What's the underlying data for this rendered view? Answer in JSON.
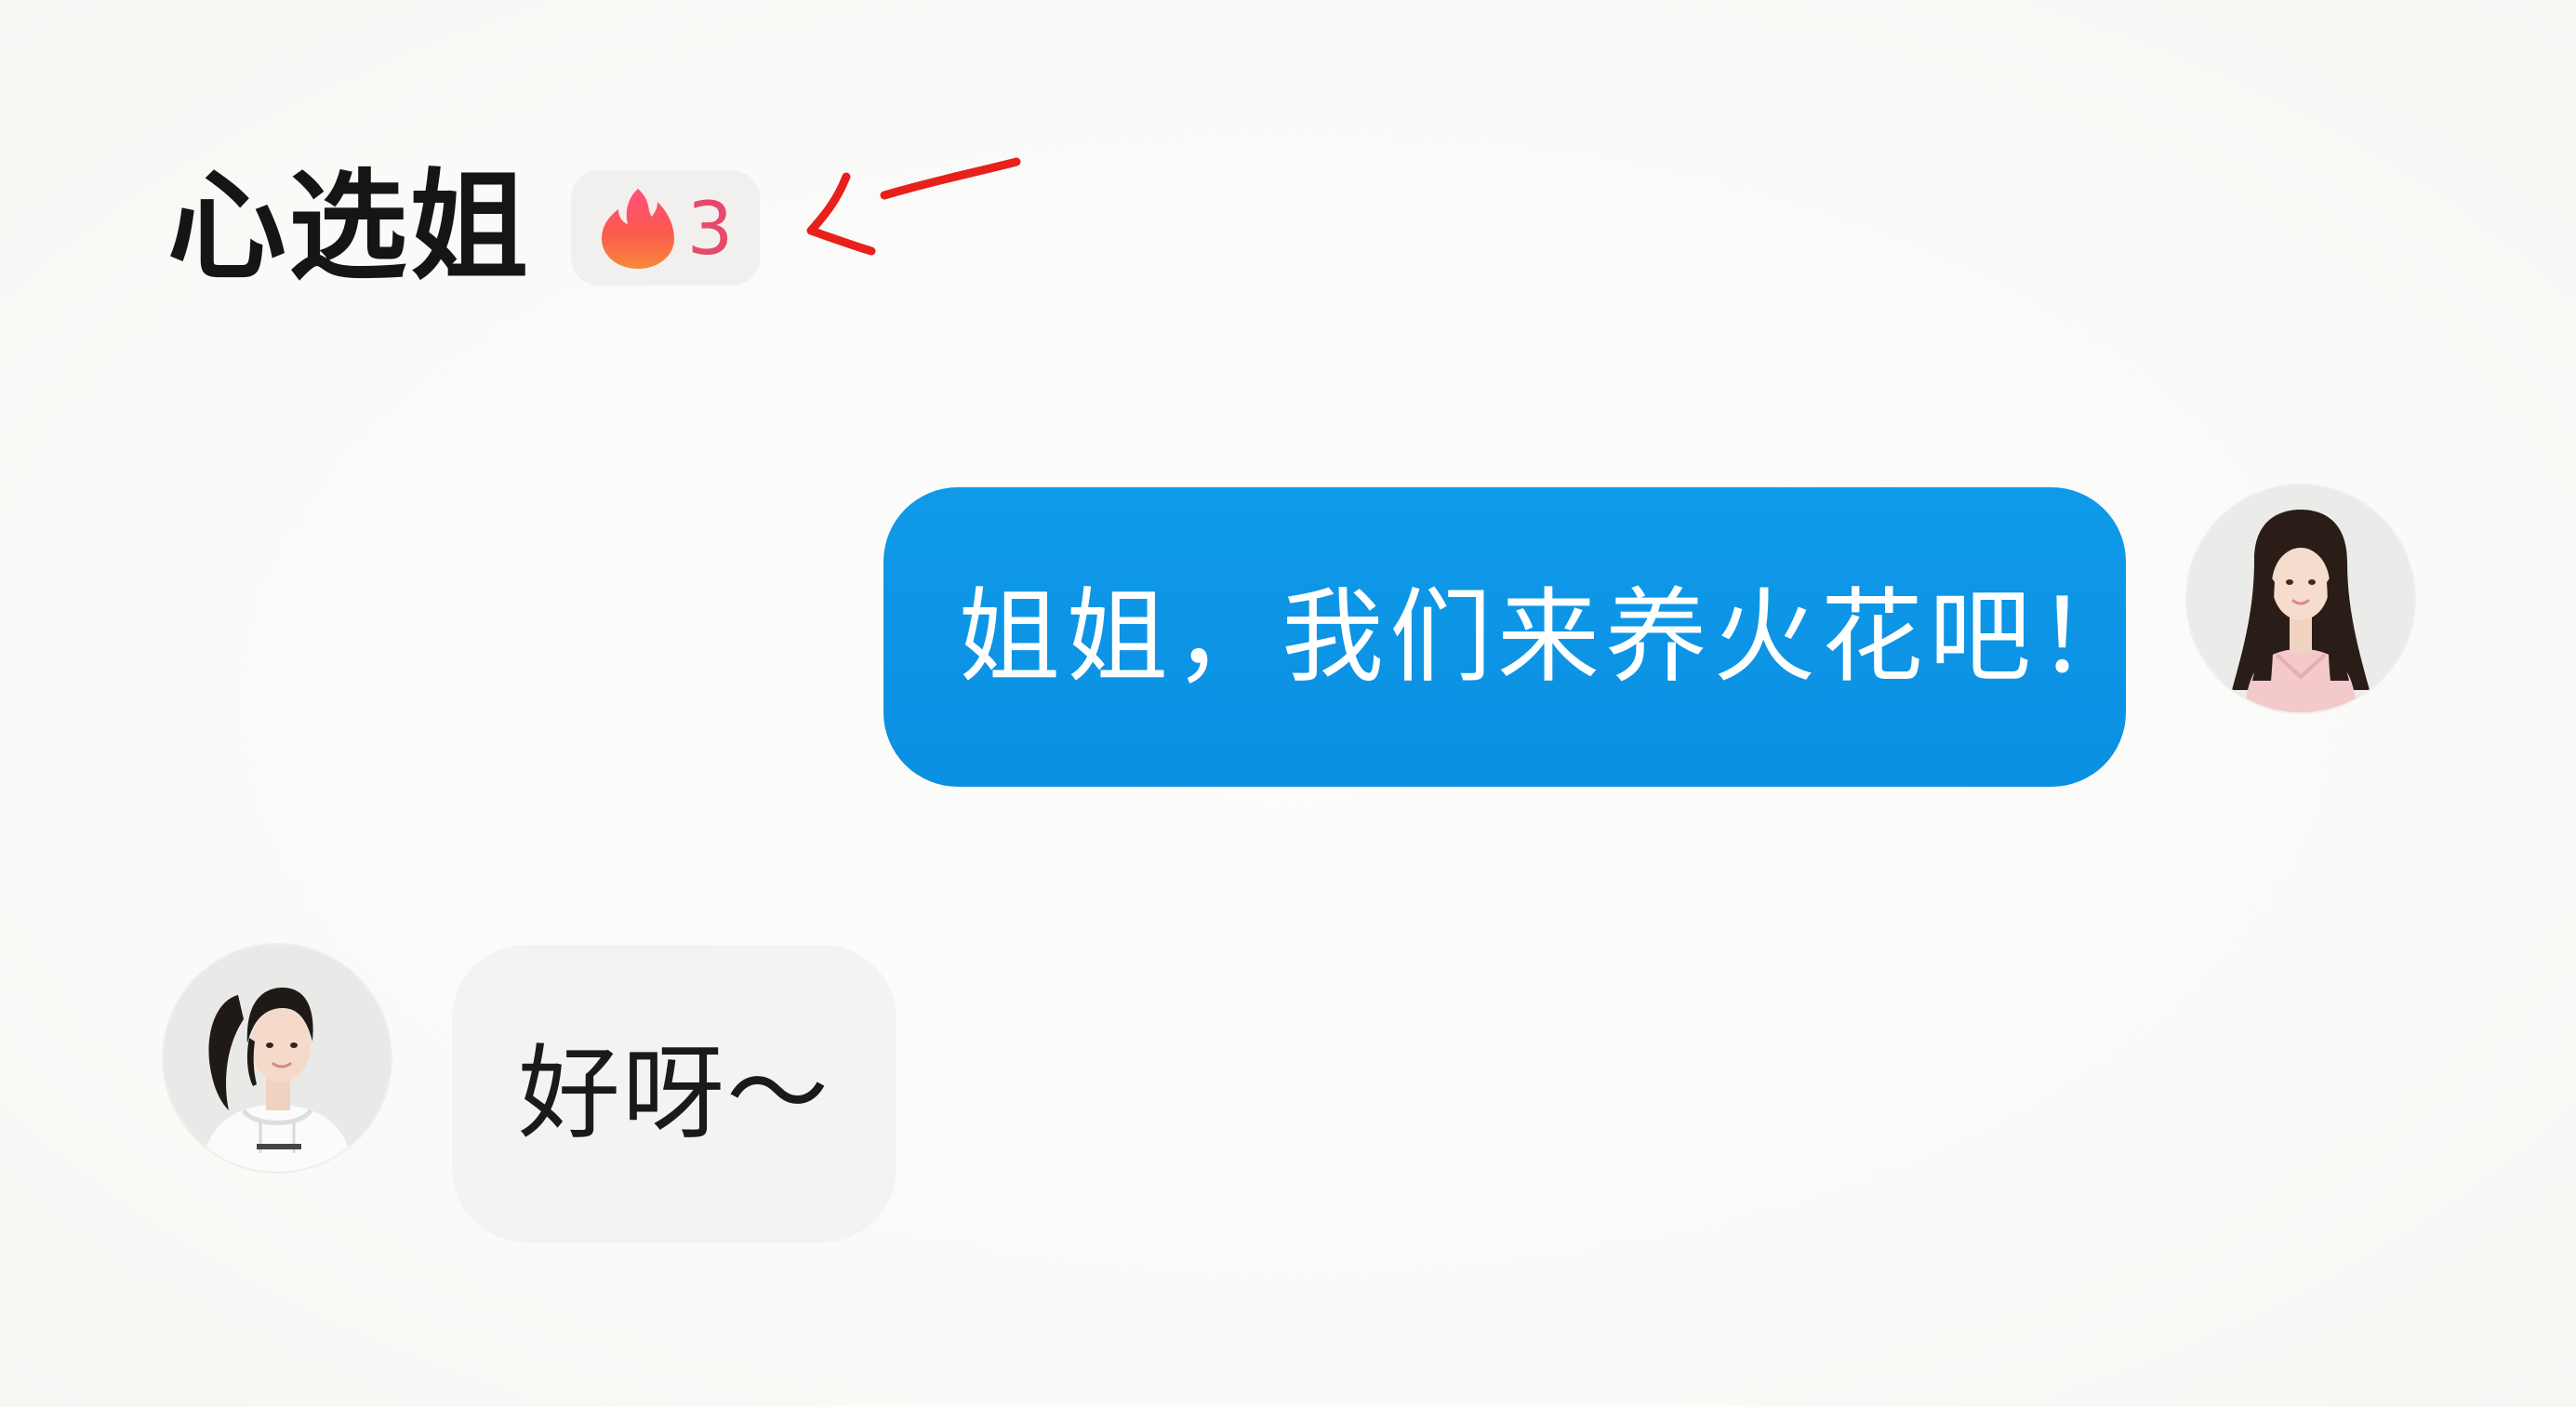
{
  "chat": {
    "contact_name": "心选姐",
    "streak": {
      "icon": "flame-icon",
      "count": "3",
      "count_color": "#e64a6a",
      "badge_color": "#f1f0ee"
    },
    "annotation": {
      "icon": "red-arrow-icon",
      "color": "#e8201c"
    }
  },
  "messages": [
    {
      "sender": "me",
      "text": "姐姐，我们来养火花吧！",
      "bubble_color": "#0b8fe2",
      "avatar_icon": "avatar-long-hair-pink-dress"
    },
    {
      "sender": "friend",
      "text": "好呀～",
      "bubble_color": "#f3f3f2",
      "avatar_icon": "avatar-ponytail-white-hoodie"
    }
  ]
}
